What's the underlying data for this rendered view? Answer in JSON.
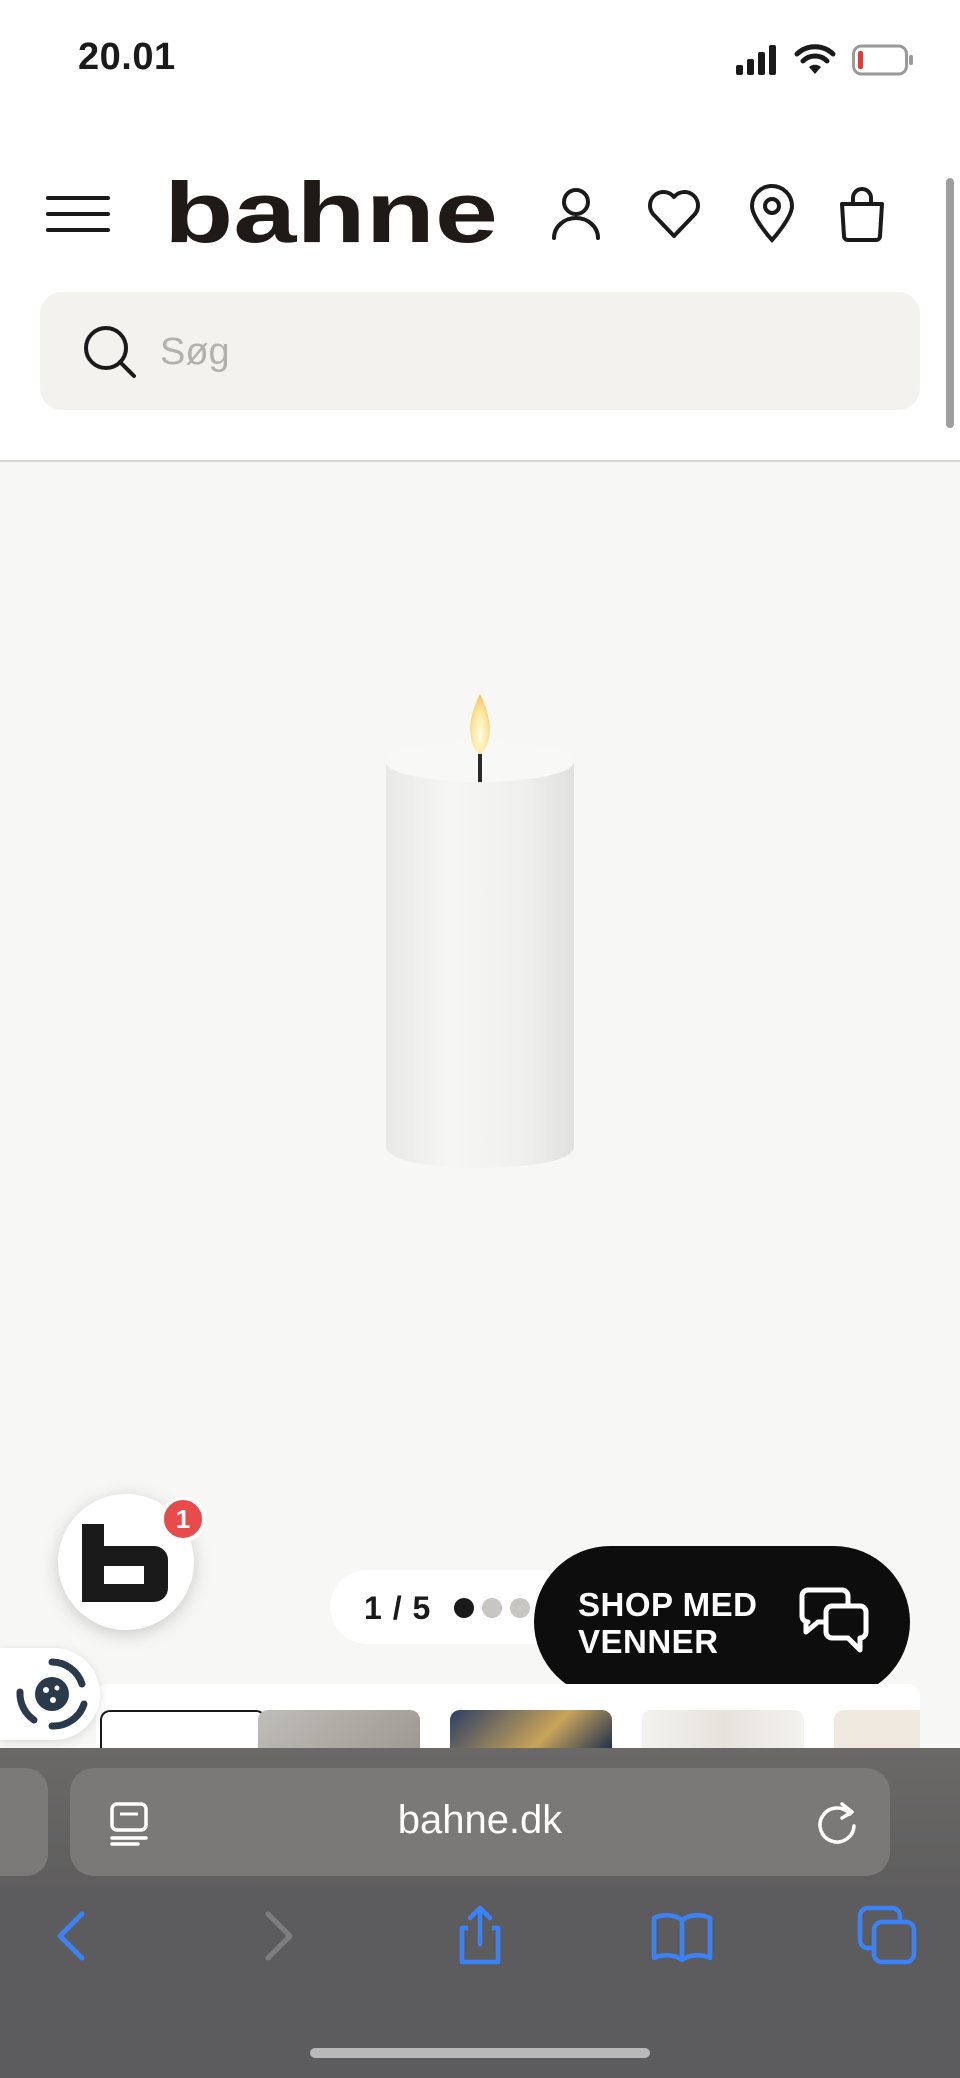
{
  "status_bar": {
    "time": "20.01",
    "icons": [
      "signal-icon",
      "wifi-icon",
      "battery-low-icon"
    ]
  },
  "header": {
    "logo_text": "bahne",
    "icons": [
      "menu-icon",
      "account-icon",
      "wishlist-icon",
      "store-locator-icon",
      "bag-icon"
    ]
  },
  "search": {
    "placeholder": "Søg",
    "value": ""
  },
  "product_gallery": {
    "image": "white LED pillar candle",
    "pager_text": "1 / 5",
    "total_images": 5,
    "current_index": 1
  },
  "floating": {
    "brand_button_icon": "bahne-b-logo-icon",
    "notification_count": "1",
    "shop_with_friends_label": "SHOP MED\nVENNER",
    "chat_icon": "chat-bubbles-icon"
  },
  "browser": {
    "url": "bahne.dk",
    "toolbar": [
      "back-icon",
      "forward-icon",
      "share-icon",
      "bookmarks-icon",
      "tabs-icon"
    ]
  },
  "colors": {
    "accent_blue": "#3b82f6",
    "badge_red": "#e94b4b",
    "search_bg": "#f3f2ef",
    "product_bg": "#f7f7f5"
  }
}
